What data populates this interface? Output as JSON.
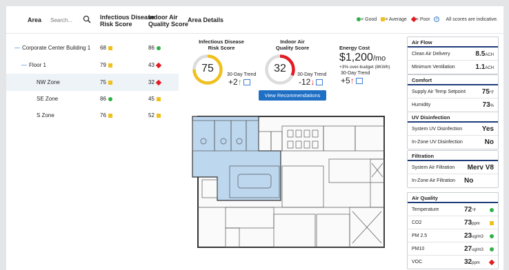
{
  "header": {
    "area_label": "Area",
    "search_placeholder": "Search...",
    "risk_col": [
      "Infectious Disease",
      "Risk Score"
    ],
    "iaq_col": [
      "Indoor Air",
      "Quality Score"
    ],
    "details_label": "Area Details",
    "legend": {
      "good": "= Good",
      "average": "= Average",
      "poor": "= Poor",
      "note": "All scores are indicative."
    }
  },
  "tree": [
    {
      "name": "Corporate Center Building 1",
      "risk": "68",
      "risk_status": "average",
      "iaq": "86",
      "iaq_status": "good"
    },
    {
      "name": "Floor 1",
      "risk": "79",
      "risk_status": "average",
      "iaq": "43",
      "iaq_status": "poor"
    },
    {
      "name": "NW Zone",
      "risk": "75",
      "risk_status": "average",
      "iaq": "32",
      "iaq_status": "poor"
    },
    {
      "name": "SE Zone",
      "risk": "86",
      "risk_status": "good",
      "iaq": "45",
      "iaq_status": "average"
    },
    {
      "name": "S Zone",
      "risk": "76",
      "risk_status": "average",
      "iaq": "52",
      "iaq_status": "average"
    }
  ],
  "gauges": {
    "risk": {
      "title": [
        "Infectious Disease",
        "Risk Score"
      ],
      "value": "75",
      "trend_label": "30-Day Trend",
      "trend": "+2",
      "fill_fraction": 0.75,
      "color": "#f0c01c"
    },
    "iaq": {
      "title": [
        "Indoor Air",
        "Quality Score"
      ],
      "value": "32",
      "trend_label": "30-Day Trend",
      "trend": "-12",
      "fill_fraction": 0.32,
      "color": "#e31b23"
    }
  },
  "energy": {
    "title": "Energy Cost",
    "value": "$1,200",
    "unit": "/mo",
    "note": "+3% over-budget (8KWh)",
    "trend_label": "30-Day Trend",
    "trend": "+5"
  },
  "actions": {
    "recommendations": "View Recommendations"
  },
  "panels": {
    "airflow": {
      "title": "Air Flow",
      "rows": [
        {
          "label": "Clean Air Delivery",
          "value": "8.5",
          "unit": "ACH"
        },
        {
          "label": "Minimum Ventilation",
          "value": "1.1",
          "unit": "ACH"
        }
      ]
    },
    "comfort": {
      "title": "Comfort",
      "rows": [
        {
          "label": "Supply Air Temp Setpoint",
          "value": "75",
          "unit": "°F"
        },
        {
          "label": "Humidity",
          "value": "73",
          "unit": "%"
        }
      ]
    },
    "uv": {
      "title": "UV Disinfection",
      "rows": [
        {
          "label": "System UV Disinfection",
          "value": "Yes"
        },
        {
          "label": "In-Zone UV Disinfection",
          "value": "No"
        }
      ]
    },
    "filtration": {
      "title": "Filtration",
      "rows": [
        {
          "label": "System Air Filtration",
          "value": "Merv V8"
        },
        {
          "label": "In-Zone Air Filtration",
          "value": "No"
        }
      ]
    },
    "airquality": {
      "title": "Air Quality",
      "rows": [
        {
          "label": "Temperature",
          "value": "72",
          "unit": "°F",
          "status": "good"
        },
        {
          "label": "CO2",
          "value": "73",
          "unit": "ppm",
          "status": "average"
        },
        {
          "label": "PM 2.5",
          "value": "23",
          "unit": "ug/m3",
          "status": "good"
        },
        {
          "label": "PM10",
          "value": "27",
          "unit": "ug/m3",
          "status": "good"
        },
        {
          "label": "VOC",
          "value": "32",
          "unit": "ppm",
          "status": "poor"
        }
      ]
    }
  },
  "colors": {
    "good": "#2db14a",
    "average": "#f0c01c",
    "poor": "#e31b23",
    "accent": "#1f6fc5",
    "panel_header": "#1c3a78"
  }
}
